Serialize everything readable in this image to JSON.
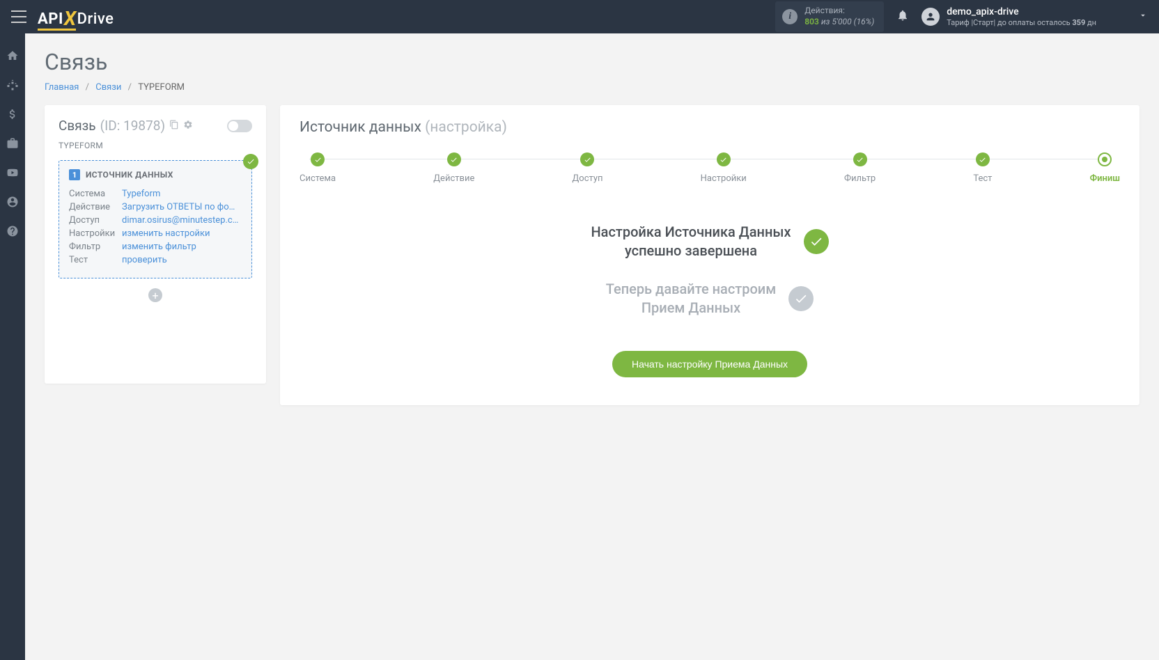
{
  "topbar": {
    "actions": {
      "label": "Действия:",
      "count": "803",
      "of_text": "из",
      "total": "5'000",
      "percent": "(16%)"
    },
    "user": {
      "name": "demo_apix-drive",
      "tariff_prefix": "Тариф |Старт| до оплаты осталось",
      "days": "359",
      "days_suffix": "дн"
    }
  },
  "page": {
    "title": "Связь",
    "breadcrumb": {
      "home": "Главная",
      "links": "Связи",
      "current": "TYPEFORM"
    }
  },
  "left_panel": {
    "title": "Связь",
    "id": "(ID: 19878)",
    "subtitle": "TYPEFORM",
    "source": {
      "number": "1",
      "title": "ИСТОЧНИК ДАННЫХ",
      "rows": [
        {
          "label": "Система",
          "value": "Typeform"
        },
        {
          "label": "Действие",
          "value": "Загрузить ОТВЕТЫ по форм"
        },
        {
          "label": "Доступ",
          "value": "dimar.osirus@minutestep.com"
        },
        {
          "label": "Настройки",
          "value": "изменить настройки"
        },
        {
          "label": "Фильтр",
          "value": "изменить фильтр"
        },
        {
          "label": "Тест",
          "value": "проверить"
        }
      ]
    }
  },
  "right_panel": {
    "title": "Источник данных",
    "title_muted": "(настройка)",
    "steps": [
      {
        "label": "Система",
        "state": "done"
      },
      {
        "label": "Действие",
        "state": "done"
      },
      {
        "label": "Доступ",
        "state": "done"
      },
      {
        "label": "Настройки",
        "state": "done"
      },
      {
        "label": "Фильтр",
        "state": "done"
      },
      {
        "label": "Тест",
        "state": "done"
      },
      {
        "label": "Финиш",
        "state": "current"
      }
    ],
    "status_done_line1": "Настройка Источника Данных",
    "status_done_line2": "успешно завершена",
    "status_pending_line1": "Теперь давайте настроим",
    "status_pending_line2": "Прием Данных",
    "button": "Начать настройку Приема Данных"
  }
}
